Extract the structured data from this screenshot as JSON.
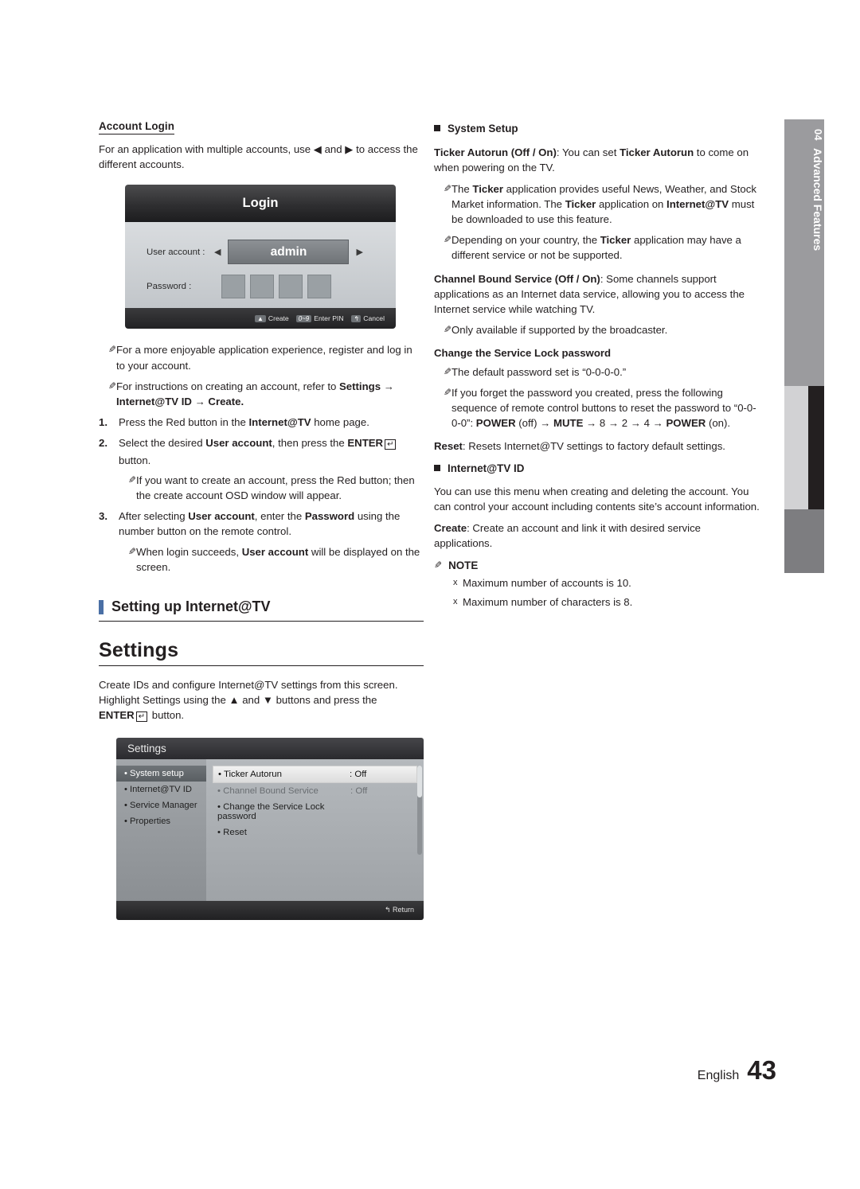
{
  "left": {
    "account_login_heading": "Account Login",
    "intro": "For an application with multiple accounts, use ◀ and ▶ to access the different accounts.",
    "login_osd": {
      "title": "Login",
      "user_account_label": "User account :",
      "user_account_value": "admin",
      "password_label": "Password :",
      "left_arrow": "◀",
      "right_arrow": "▶",
      "footer": {
        "create_key": "▲",
        "create_label": "Create",
        "pin_key": "0~9",
        "pin_label": "Enter PIN",
        "cancel_key": "↰",
        "cancel_label": "Cancel"
      }
    },
    "notes": [
      "For a more enjoyable application experience, register and log in to your account.",
      "For instructions on creating an account, refer to Settings → Internet@TV ID → Create."
    ],
    "note2_bold": "Settings → Internet@TV ID → Create.",
    "steps": [
      {
        "n": "1.",
        "text": "Press the Red button in the Internet@TV home page."
      },
      {
        "n": "2.",
        "text": "Select the desired User account, then press the ENTER button."
      },
      {
        "n": "3.",
        "text": "After selecting User account, enter the Password using the number button on the remote control."
      }
    ],
    "step2_sub": "If you want to create an account, press the Red button; then the create account OSD window will appear.",
    "step3_sub": "When login succeeds, User account will be displayed on the screen.",
    "bar_heading": "Setting up Internet@TV",
    "settings_heading": "Settings",
    "settings_intro": "Create IDs and configure Internet@TV settings from this screen. Highlight Settings using the ▲ and ▼ buttons and press the ENTER button.",
    "settings_osd": {
      "title": "Settings",
      "menu": [
        "• System setup",
        "• Internet@TV ID",
        "• Service Manager",
        "• Properties"
      ],
      "items": [
        {
          "name": "• Ticker Autorun",
          "value": ": Off"
        },
        {
          "name": "• Channel Bound Service",
          "value": ": Off"
        },
        {
          "name": "• Change the Service Lock password",
          "value": ""
        },
        {
          "name": "• Reset",
          "value": ""
        }
      ],
      "footer": "↰ Return"
    }
  },
  "right": {
    "system_setup_heading": "System Setup",
    "ticker_autorun": "Ticker Autorun (Off / On): You can set Ticker Autorun to come on when powering on the TV.",
    "ticker_notes": [
      "The Ticker application provides useful News, Weather, and Stock Market information. The Ticker application on Internet@TV must be downloaded to use this feature.",
      "Depending on your country, the Ticker application may have a different service or not be supported."
    ],
    "channel_bound": "Channel Bound Service (Off / On): Some channels support applications as an Internet data service, allowing you to access the Internet service while watching TV.",
    "channel_bound_note": "Only available if supported by the broadcaster.",
    "change_lock_heading": "Change the Service Lock password",
    "lock_notes": [
      "The default password set is “0-0-0-0.”",
      "If you forget the password you created, press the following sequence of remote control buttons to reset the password to “0-0-0-0”: POWER (off) → MUTE → 8 → 2 → 4 → POWER (on)."
    ],
    "reset_text": "Reset: Resets Internet@TV settings to factory default settings.",
    "internettv_id_heading": "Internet@TV ID",
    "internettv_id_text": "You can use this menu when creating and deleting the account. You can control your account including contents site’s account information.",
    "create_text": "Create: Create an account and link it with desired service applications.",
    "note_label": "NOTE",
    "note_items": [
      "Maximum number of accounts is 10.",
      "Maximum number of characters is 8."
    ]
  },
  "chapter_tab": {
    "number": "04",
    "label": "Advanced Features"
  },
  "footer": {
    "language": "English",
    "page_number": "43"
  }
}
